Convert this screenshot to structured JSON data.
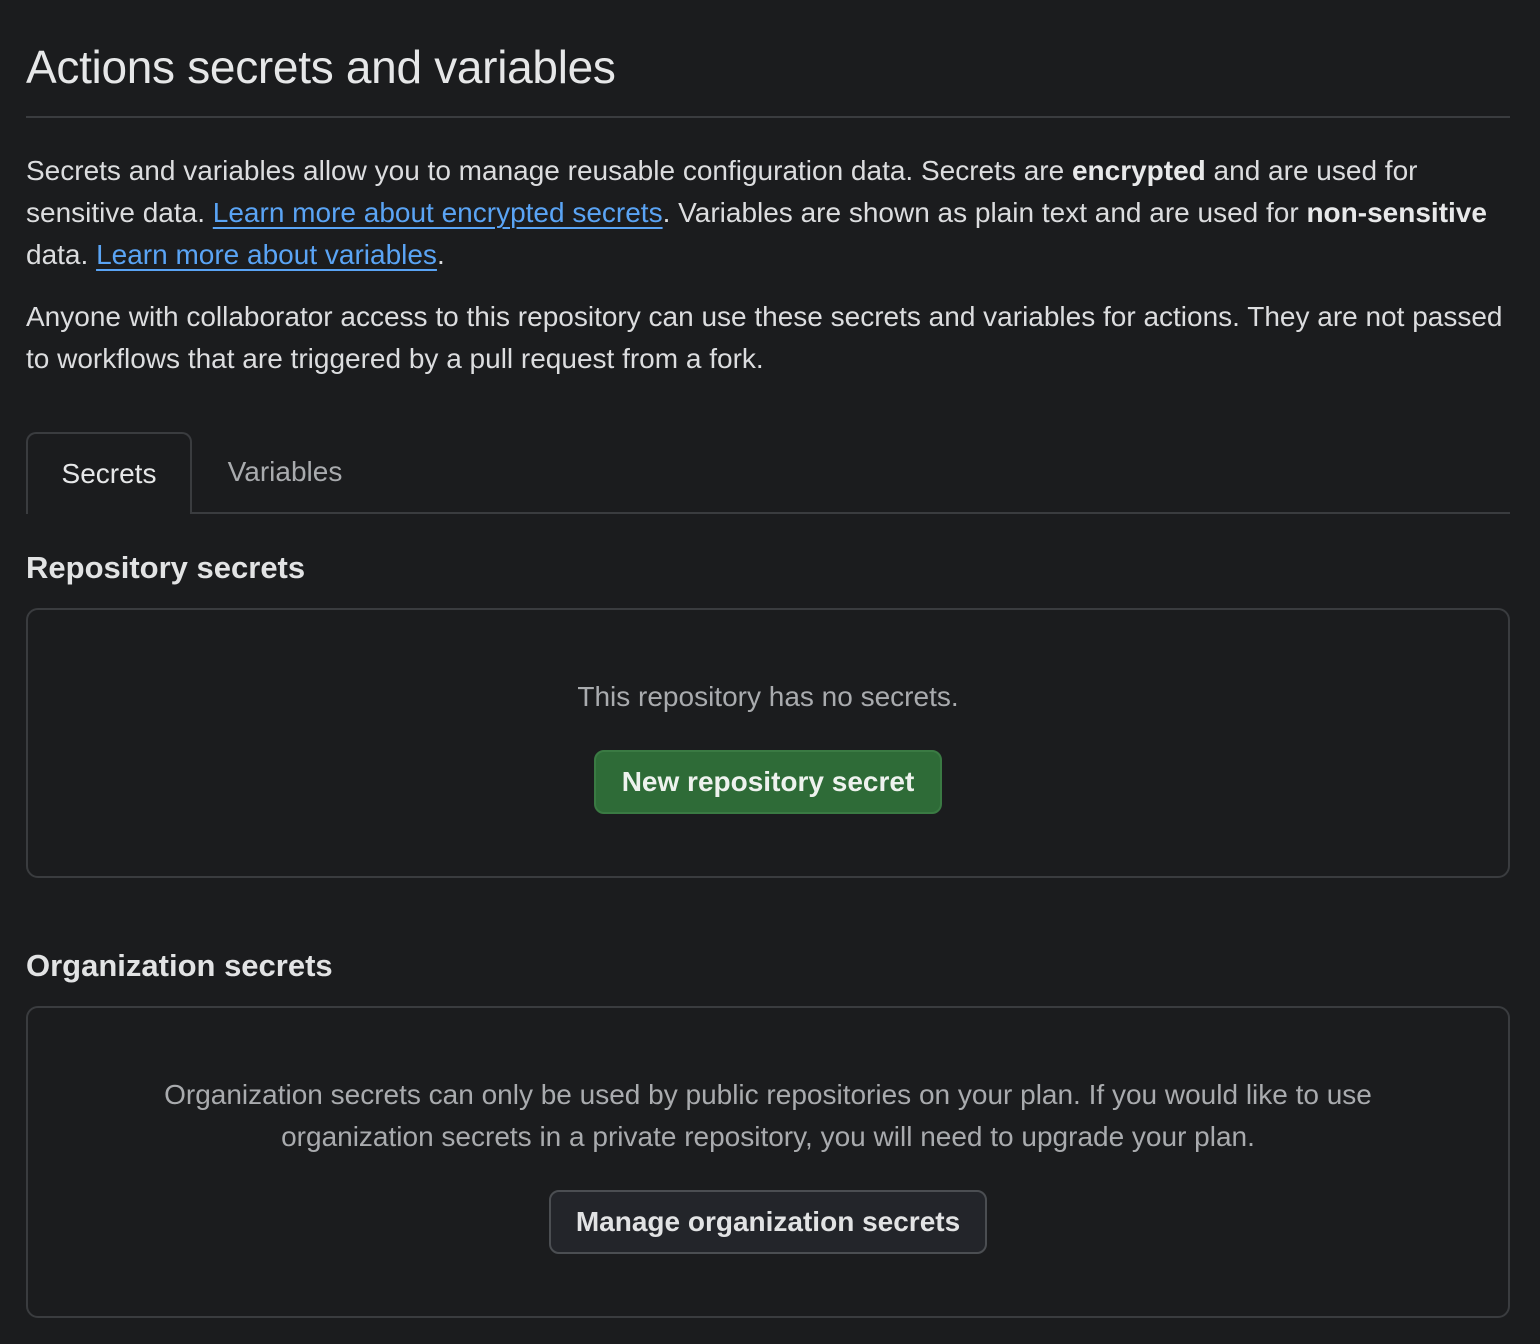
{
  "page": {
    "title": "Actions secrets and variables"
  },
  "intro": {
    "text_1": "Secrets and variables allow you to manage reusable configuration data. Secrets are ",
    "bold_1": "encrypted",
    "text_2": " and are used for sensitive data. ",
    "link_1": "Learn more about encrypted secrets",
    "text_3": ". Variables are shown as plain text and are used for ",
    "bold_2": "non-sensitive",
    "text_4": " data. ",
    "link_2": "Learn more about variables",
    "text_5": "."
  },
  "note": "Anyone with collaborator access to this repository can use these secrets and variables for actions. They are not passed to workflows that are triggered by a pull request from a fork.",
  "tabs": [
    {
      "label": "Secrets",
      "selected": true
    },
    {
      "label": "Variables",
      "selected": false
    }
  ],
  "repository_secrets": {
    "heading": "Repository secrets",
    "empty_message": "This repository has no secrets.",
    "button_label": "New repository secret"
  },
  "organization_secrets": {
    "heading": "Organization secrets",
    "message": "Organization secrets can only be used by public repositories on your plan. If you would like to use organization secrets in a private repository, you will need to upgrade your plan.",
    "button_label": "Manage organization secrets"
  },
  "colors": {
    "background": "#1b1c1e",
    "border": "#3a3c3f",
    "link": "#5aa4f5",
    "primary_button": "#2e6b37",
    "muted_text": "#a9abae"
  }
}
